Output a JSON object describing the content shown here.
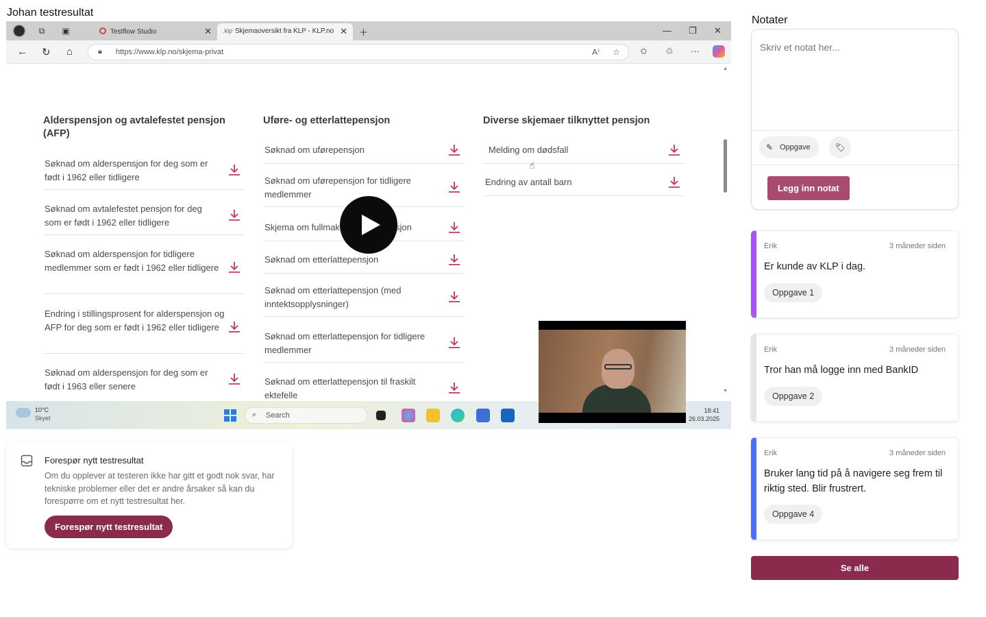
{
  "page": {
    "title": "Johan testresultat"
  },
  "browser": {
    "tabs": [
      {
        "label": "Testflow Studio"
      },
      {
        "label": "Skjemaoversikt fra KLP - KLP.no",
        "favicon": "klp"
      }
    ],
    "url": "https://www.klp.no/skjema-privat"
  },
  "forms": {
    "columns": [
      {
        "heading": "Alderspensjon og avtalefestet pensjon (AFP)",
        "items": [
          "Søknad om alderspensjon for deg som er født i 1962 eller tidligere",
          "Søknad om avtalefestet pensjon for deg som er født i 1962 eller tidligere",
          "Søknad om alderspensjon for tidligere medlemmer som er født i 1962 eller tidligere",
          "Endring i stillingsprosent for alderspensjon og AFP for deg som er født i 1962 eller tidligere",
          "Søknad om alderspensjon for deg som er født i 1963 eller senere"
        ]
      },
      {
        "heading": "Uføre- og etterlattepensjon",
        "items": [
          "Søknad om uførepensjon",
          "Søknad om uførepensjon for tidligere medlemmer",
          "Skjema om fullmakt",
          "sjon",
          "Søknad om etterlattepensjon",
          "Søknad om etterlattepensjon (med inntektsopplysninger)",
          "Søknad om etterlattepensjon for tidligere medlemmer",
          "Søknad om etterlattepensjon til fraskilt ektefelle"
        ]
      },
      {
        "heading": "Diverse skjemaer tilknyttet pensjon",
        "items": [
          "Melding om dødsfall",
          "Endring av antall barn"
        ]
      }
    ]
  },
  "taskbar": {
    "weather_temp": "10°C",
    "weather_desc": "Skyet",
    "search_placeholder": "Search",
    "time": "18:41",
    "date": "26.03.2025"
  },
  "request": {
    "title": "Forespør nytt testresultat",
    "description": "Om du opplever at testeren ikke har gitt et godt nok svar, har tekniske problemer eller det er andre årsaker så kan du forespørre om et nytt testresultat her.",
    "button": "Forespør nytt testresultat"
  },
  "notes": {
    "title": "Notater",
    "placeholder": "Skriv et notat her...",
    "task_chip": "Oppgave",
    "submit": "Legg inn notat",
    "items": [
      {
        "author": "Erik",
        "time": "3 måneder siden",
        "text": "Er kunde av KLP i dag.",
        "tag": "Oppgave 1",
        "color": "#a855f7"
      },
      {
        "author": "Erik",
        "time": "3 måneder siden",
        "text": "Tror han må logge inn med BankID",
        "tag": "Oppgave 2",
        "color": "#e5e5e5"
      },
      {
        "author": "Erik",
        "time": "3 måneder siden",
        "text": "Bruker lang tid på å navigere seg frem til riktig sted. Blir frustrert.",
        "tag": "Oppgave 4",
        "color": "#4f6ef7"
      }
    ],
    "see_all": "Se alle"
  },
  "colors": {
    "accent": "#8a2a4c",
    "accent_light": "#a84b6e",
    "download_icon": "#c0395e"
  }
}
